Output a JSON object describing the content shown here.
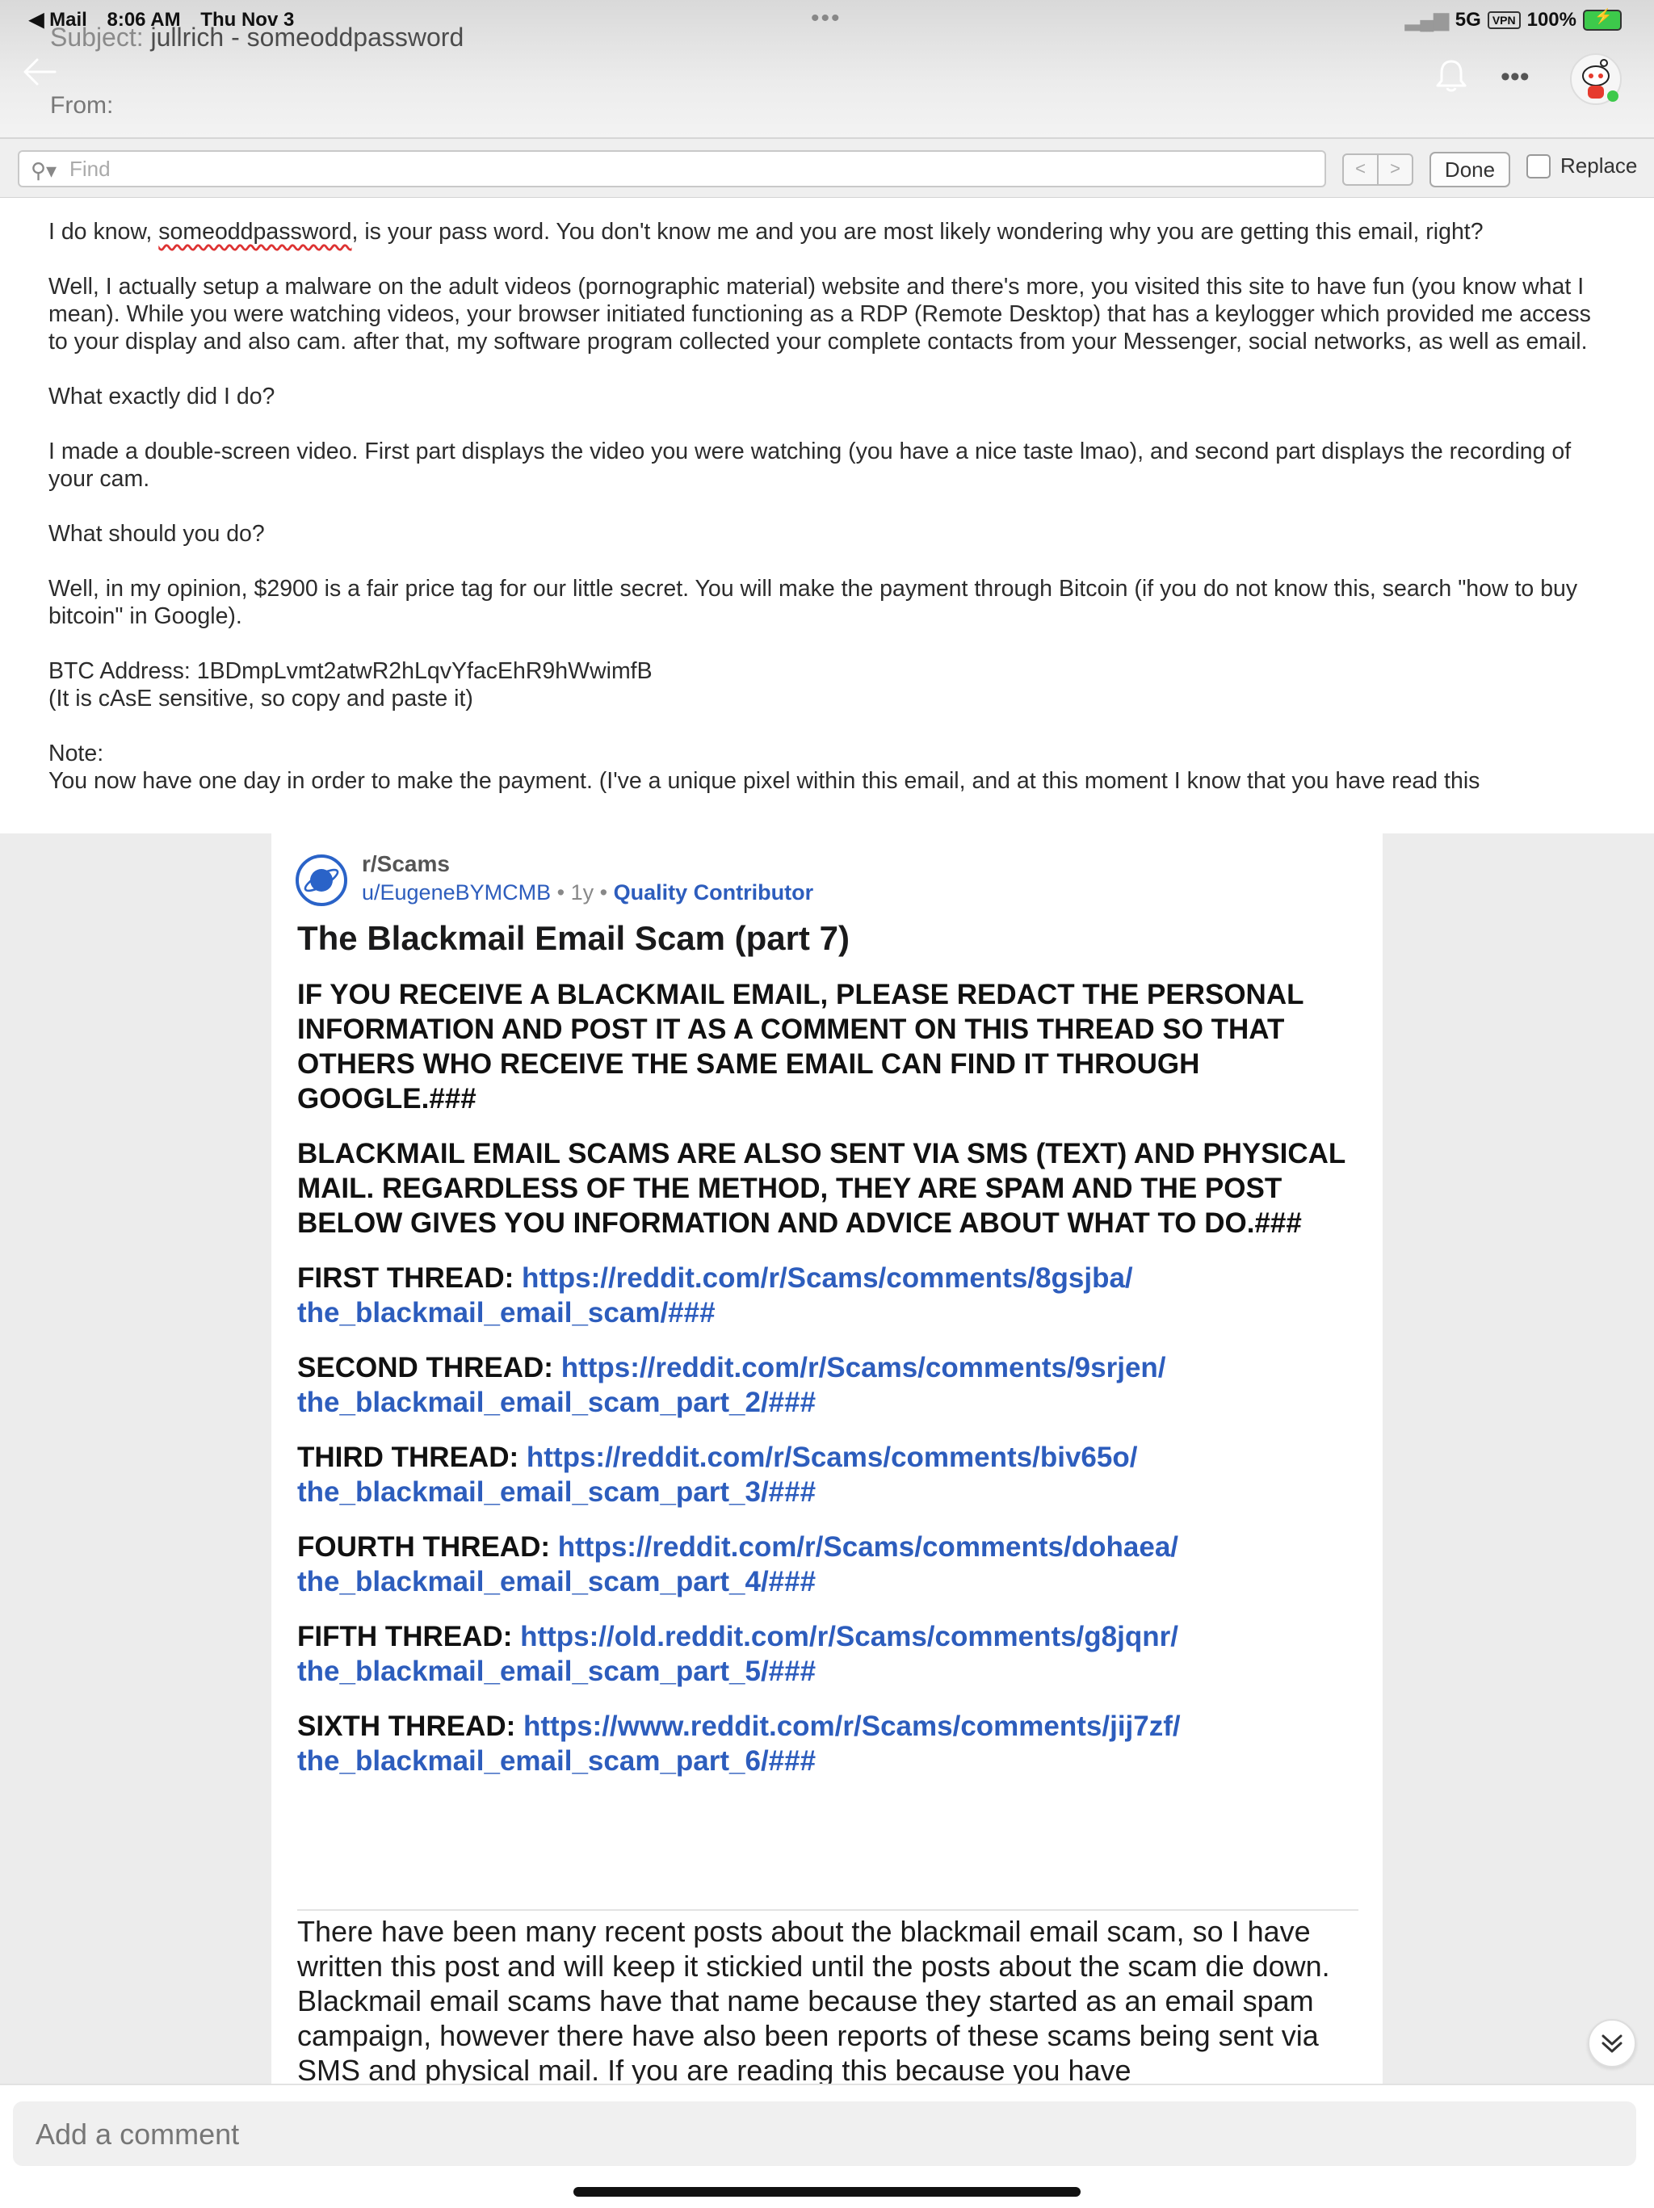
{
  "status_bar": {
    "app": "◀ Mail",
    "time": "8:06 AM",
    "date": "Thu Nov 3",
    "network": "5G",
    "vpn": "VPN",
    "battery": "100%"
  },
  "email": {
    "subject_label": "Subject:",
    "subject_value": "jullrich - someoddpassword",
    "from_label": "From:",
    "find_placeholder": "Find",
    "done_label": "Done",
    "replace_label": "Replace",
    "body": {
      "p1_a": "I do know, ",
      "p1_pw": "someoddpassword",
      "p1_b": ", is your pass word. You don't know me and you are most likely wondering why you are getting this email, right?",
      "p2": "Well, I actually setup a malware on the adult videos (pornographic material) website and there's more, you visited this site to have fun (you know what I mean). While you were watching videos, your browser initiated functioning as a RDP (Remote Desktop) that has a keylogger which provided me access to your display and also cam. after that, my software program collected your complete contacts from your Messenger, social networks, as well as email.",
      "p3": "What exactly did I do?",
      "p4": "I made a double-screen video. First part displays the video you were watching (you have a nice taste lmao), and second part displays the recording of your cam.",
      "p5": "What should you do?",
      "p6": "Well, in my opinion, $2900 is a fair price tag for our little secret. You will make the payment through Bitcoin (if you do not know this, search \"how to buy bitcoin\" in Google).",
      "p7_line1": "BTC Address: 1BDmpLvmt2atwR2hLqvYfacEhR9hWwimfB",
      "p7_line2": "(It is cAsE sensitive, so copy and paste it)",
      "p8_line1": "Note:",
      "p8_line2": "You now have one day in order to make the payment. (I've a unique pixel within this email, and at this moment I know that you have read this"
    }
  },
  "post": {
    "subreddit": "r/Scams",
    "username": "u/EugeneBYMCMB",
    "age": "1y",
    "flair": "Quality Contributor",
    "title": "The Blackmail Email Scam (part 7)",
    "notice1": "IF YOU RECEIVE A BLACKMAIL EMAIL, PLEASE REDACT THE PERSONAL INFORMATION AND POST IT AS A COMMENT ON THIS THREAD SO THAT OTHERS WHO RECEIVE THE SAME EMAIL CAN FIND IT THROUGH GOOGLE.###",
    "notice2": "BLACKMAIL EMAIL SCAMS ARE ALSO SENT VIA SMS (TEXT) AND PHYSICAL MAIL. REGARDLESS OF THE METHOD, THEY ARE SPAM AND THE POST BELOW GIVES YOU INFORMATION AND ADVICE ABOUT WHAT TO DO.###",
    "threads": [
      {
        "label": "FIRST THREAD:",
        "url_a": "https://reddit.com/r/Scams/comments/8gsjba/",
        "url_b": "the_blackmail_email_scam/###"
      },
      {
        "label": "SECOND THREAD:",
        "url_a": "https://reddit.com/r/Scams/comments/9srjen/",
        "url_b": "the_blackmail_email_scam_part_2/###"
      },
      {
        "label": "THIRD THREAD:",
        "url_a": "https://reddit.com/r/Scams/comments/biv65o/",
        "url_b": "the_blackmail_email_scam_part_3/###"
      },
      {
        "label": "FOURTH THREAD:",
        "url_a": "https://reddit.com/r/Scams/comments/dohaea/",
        "url_b": "the_blackmail_email_scam_part_4/###"
      },
      {
        "label": "FIFTH THREAD:",
        "url_a": "https://old.reddit.com/r/Scams/comments/g8jqnr/",
        "url_b": "the_blackmail_email_scam_part_5/###"
      },
      {
        "label": "SIXTH THREAD:",
        "url_a": "https://www.reddit.com/r/Scams/comments/jij7zf/",
        "url_b": "the_blackmail_email_scam_part_6/###"
      }
    ],
    "paragraph": "There have been many recent posts about the blackmail email scam, so I have written this post and will keep it stickied until the posts about the scam die down. Blackmail email scams have that name because they started as an email spam campaign, however there have also been reports of these scams being sent via SMS and physical mail. If you are reading this because you have"
  },
  "comment": {
    "placeholder": "Add a comment"
  },
  "colors": {
    "link": "#2d5dbd",
    "battery": "#3dc94b"
  },
  "icons": [
    "back-arrow-icon",
    "bell-icon",
    "more-icon",
    "search-icon",
    "subreddit-icon",
    "chevron-down-icon"
  ]
}
